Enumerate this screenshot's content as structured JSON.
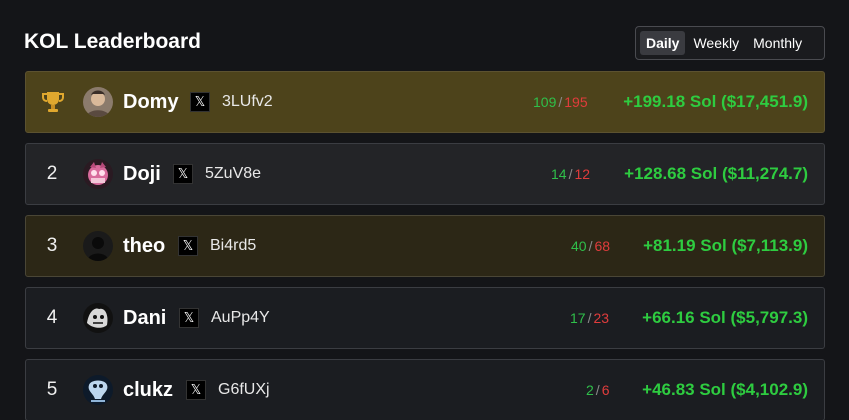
{
  "header": {
    "title": "KOL Leaderboard",
    "periods": [
      "Daily",
      "Weekly",
      "Monthly"
    ],
    "active_period": "Daily"
  },
  "leaderboard": [
    {
      "rank": "1",
      "rank_icon": "trophy-icon",
      "name": "Domy",
      "social_icon": "x-logo-icon",
      "wallet": "3LUfv2",
      "wins": "109",
      "losses": "195",
      "pnl": "+199.18 Sol ($17,451.9)"
    },
    {
      "rank": "2",
      "name": "Doji",
      "social_icon": "x-logo-icon",
      "wallet": "5ZuV8e",
      "wins": "14",
      "losses": "12",
      "pnl": "+128.68 Sol ($11,274.7)"
    },
    {
      "rank": "3",
      "name": "theo",
      "social_icon": "x-logo-icon",
      "wallet": "Bi4rd5",
      "wins": "40",
      "losses": "68",
      "pnl": "+81.19 Sol ($7,113.9)"
    },
    {
      "rank": "4",
      "name": "Dani",
      "social_icon": "x-logo-icon",
      "wallet": "AuPp4Y",
      "wins": "17",
      "losses": "23",
      "pnl": "+66.16 Sol ($5,797.3)"
    },
    {
      "rank": "5",
      "name": "clukz",
      "social_icon": "x-logo-icon",
      "wallet": "G6fUXj",
      "wins": "2",
      "losses": "6",
      "pnl": "+46.83 Sol ($4,102.9)"
    }
  ],
  "separator": "/",
  "colors": {
    "background": "#141518",
    "row_first": "#4d431b",
    "row_third": "#2c2716",
    "win": "#2fbf4a",
    "loss": "#e03c3c",
    "pnl": "#2ecc40"
  }
}
